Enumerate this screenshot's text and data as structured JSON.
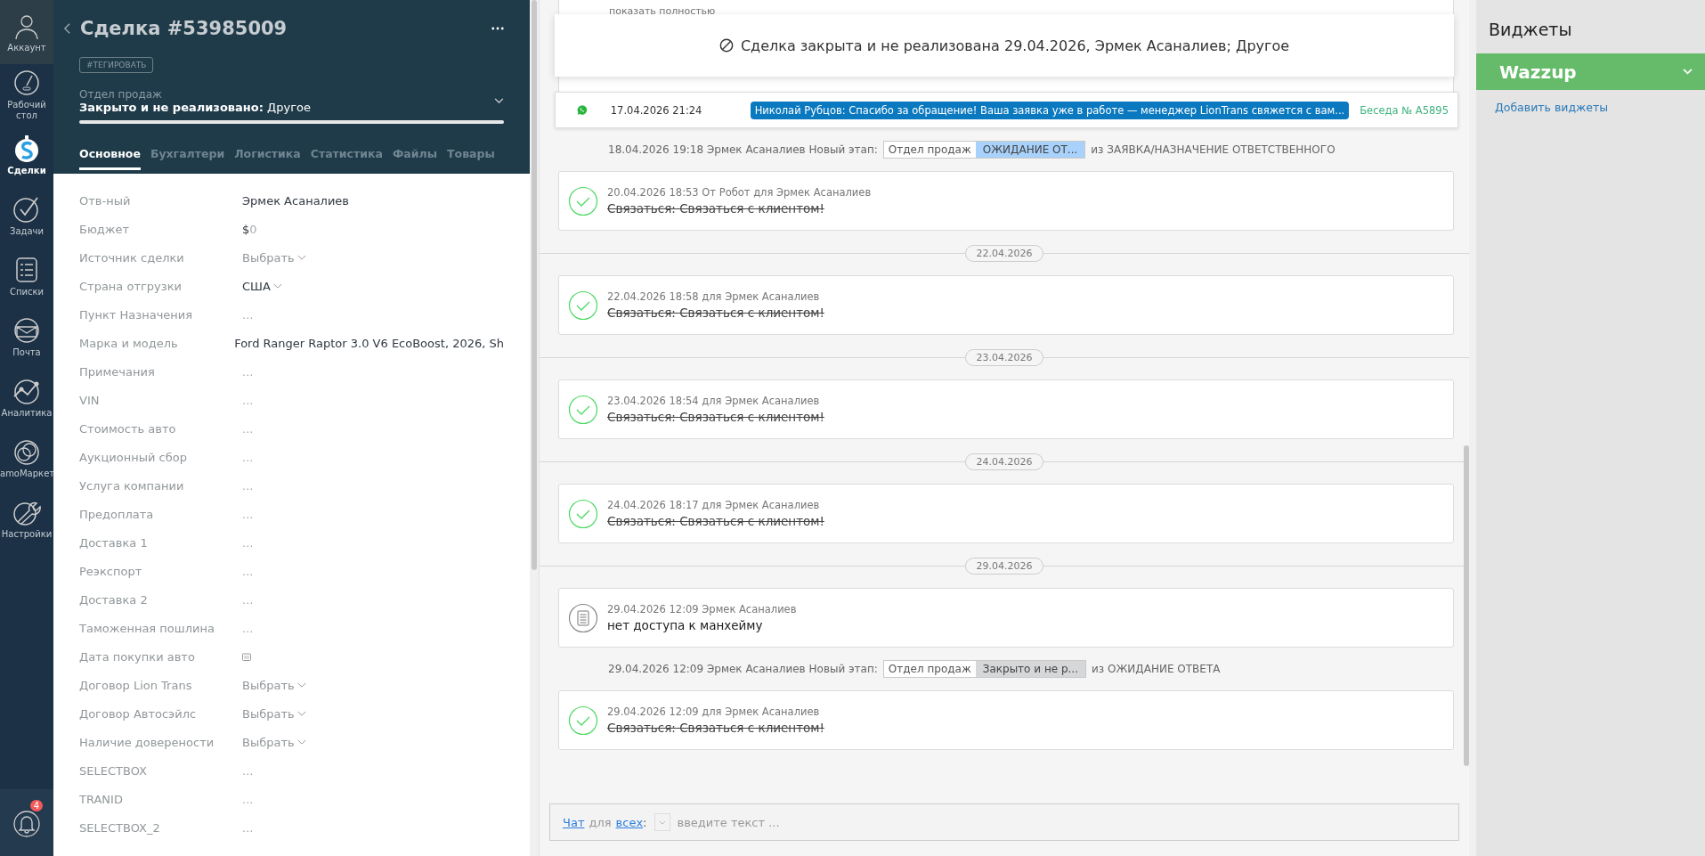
{
  "nav": {
    "items": [
      {
        "label": "Аккаунт",
        "selected": false
      },
      {
        "label": "Рабочий стол",
        "selected": false
      },
      {
        "label": "Сделки",
        "selected": true
      },
      {
        "label": "Задачи",
        "selected": false
      },
      {
        "label": "Списки",
        "selected": false
      },
      {
        "label": "Почта",
        "selected": false
      },
      {
        "label": "Аналитика",
        "selected": false
      },
      {
        "label": "amoМаркет",
        "selected": false
      },
      {
        "label": "Настройки",
        "selected": false
      }
    ],
    "notifications": "4"
  },
  "lead": {
    "title": "Сделка #53985009",
    "tag_button": "#ТЕГИРОВАТЬ",
    "pipeline": "Отдел продаж",
    "status": "**Закрыто и не реализовано:** Другое",
    "progress": {
      "level": 1
    },
    "tabs": [
      {
        "label": "Основное",
        "selected": true
      },
      {
        "label": "Бухгалтери",
        "selected": false
      },
      {
        "label": "Логистика",
        "selected": false
      },
      {
        "label": "Статистика",
        "selected": false
      },
      {
        "label": "Файлы",
        "selected": false
      },
      {
        "label": "Товары",
        "selected": false
      }
    ],
    "fields": [
      {
        "label": "Отв-ный",
        "kind": "text",
        "value": "Эрмек Асаналиев"
      },
      {
        "label": "Бюджет",
        "kind": "money",
        "currency": "$",
        "value": "0"
      },
      {
        "label": "Источник сделки",
        "kind": "select",
        "placeholder": "Выбрать"
      },
      {
        "label": "Страна отгрузки",
        "kind": "select_filled",
        "value": "США"
      },
      {
        "label": "Пункт Назначения",
        "kind": "empty",
        "value": "..."
      },
      {
        "label": "Марка и модель",
        "kind": "text",
        "value": "Ford Ranger Raptor 3.0 V6 EcoBoost, 2026, Sh"
      },
      {
        "label": "Примечания",
        "kind": "empty",
        "value": "..."
      },
      {
        "label": "VIN",
        "kind": "empty",
        "value": "..."
      },
      {
        "label": "Стоимость авто",
        "kind": "empty",
        "value": "..."
      },
      {
        "label": "Аукционный сбор",
        "kind": "empty",
        "value": "..."
      },
      {
        "label": "Услуга компании",
        "kind": "empty",
        "value": "..."
      },
      {
        "label": "Предоплата",
        "kind": "empty",
        "value": "..."
      },
      {
        "label": "Доставка 1",
        "kind": "empty",
        "value": "..."
      },
      {
        "label": "Реэкспорт",
        "kind": "empty",
        "value": "..."
      },
      {
        "label": "Доставка 2",
        "kind": "empty",
        "value": "..."
      },
      {
        "label": "Таможенная пошлина",
        "kind": "empty",
        "value": "..."
      },
      {
        "label": "Дата покупки авто",
        "kind": "date"
      },
      {
        "label": "Договор Lion Trans",
        "kind": "select",
        "placeholder": "Выбрать"
      },
      {
        "label": "Договор Автосэйлс",
        "kind": "select",
        "placeholder": "Выбрать"
      },
      {
        "label": "Наличие доверености",
        "kind": "select",
        "placeholder": "Выбрать"
      },
      {
        "label": "SELECTBOX",
        "kind": "empty",
        "value": "..."
      },
      {
        "label": "TRANID",
        "kind": "empty",
        "value": "..."
      },
      {
        "label": "SELECTBOX_2",
        "kind": "empty",
        "value": "..."
      }
    ]
  },
  "feed": {
    "banner": "Сделка закрыта и не реализована 29.04.2026, Эрмек Асаналиев; Другое",
    "chat_row": {
      "time": "17.04.2026 21:24",
      "message": "Николай Рубцов: Спасибо за обращение! Ваша заявка уже в работе — менеджер LionTrans свяжется с вам...",
      "conversation": "Беседа № A5895"
    },
    "items": [
      {
        "kind": "collapsed",
        "link": "показать полностью"
      },
      {
        "kind": "hidden"
      },
      {
        "kind": "stage",
        "meta": "18.04.2026 19:18 Эрмек Асаналиев Новый этап:",
        "pipeline": "Отдел продаж",
        "stage": "ОЖИДАНИЕ ОТ...",
        "color": "#a8d1fb",
        "from": "из ЗАЯВКА/НАЗНАЧЕНИЕ ОТВЕТСТВЕННОГО"
      },
      {
        "kind": "task",
        "meta": "20.04.2026 18:53  От Робот для Эрмек Асаналиев",
        "text": "Связаться: Связаться с клиентом!",
        "completed": true
      },
      {
        "kind": "date",
        "date": "22.04.2026"
      },
      {
        "kind": "task",
        "meta": "22.04.2026 18:58  для Эрмек Асаналиев",
        "text": "Связаться: Связаться с клиентом!",
        "completed": true
      },
      {
        "kind": "date",
        "date": "23.04.2026"
      },
      {
        "kind": "task",
        "meta": "23.04.2026 18:54  для Эрмек Асаналиев",
        "text": "Связаться: Связаться с клиентом!",
        "completed": true
      },
      {
        "kind": "date",
        "date": "24.04.2026"
      },
      {
        "kind": "task",
        "meta": "24.04.2026 18:17  для Эрмек Асаналиев",
        "text": "Связаться: Связаться с клиентом!",
        "completed": true
      },
      {
        "kind": "date",
        "date": "29.04.2026"
      },
      {
        "kind": "note",
        "meta": "29.04.2026 12:09 Эрмек Асаналиев",
        "text": "нет доступа к манхейму"
      },
      {
        "kind": "stage",
        "meta": "29.04.2026 12:09 Эрмек Асаналиев Новый этап:",
        "pipeline": "Отдел продаж",
        "stage": "Закрыто и не р...",
        "color": "#d6d7d9",
        "from": "из ОЖИДАНИЕ ОТВЕТА"
      },
      {
        "kind": "task",
        "meta": "29.04.2026 12:09  для Эрмек Асаналиев",
        "text": "Связаться: Связаться с клиентом!",
        "completed": true
      }
    ],
    "composer": {
      "chat_link": "Чат",
      "for": "для",
      "recipient_link": "всех",
      "colon": ":",
      "placeholder": "введите текст ..."
    }
  },
  "widgets": {
    "title": "Виджеты",
    "items": [
      {
        "name": "Wazzup"
      }
    ],
    "add_link": "Добавить виджеты"
  }
}
